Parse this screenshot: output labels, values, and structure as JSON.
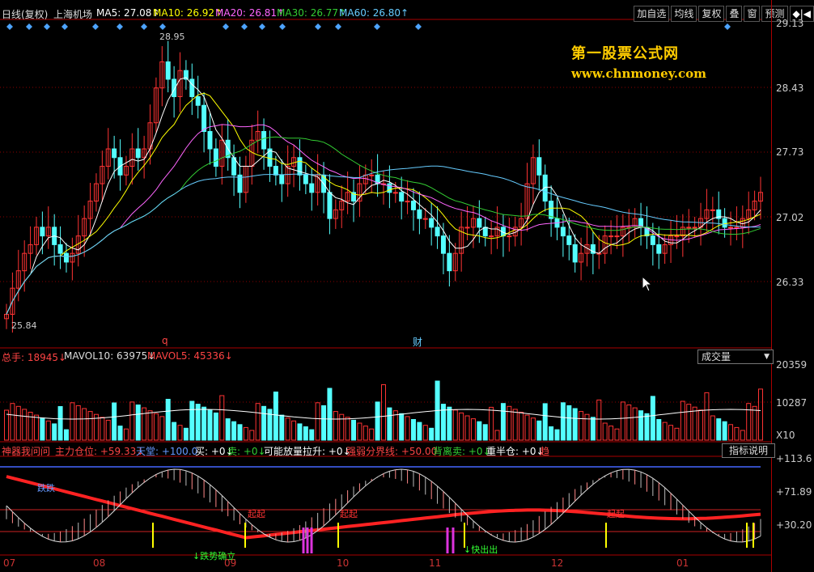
{
  "colors": {
    "up": "#ff3333",
    "down": "#54ffff",
    "ma5": "#ffffff",
    "ma10": "#ffff00",
    "ma20": "#ff66ff",
    "ma30": "#33cc33",
    "ma60": "#66ccff",
    "grid": "#8b0000",
    "thick_line": "#ff2222"
  },
  "header": {
    "period": "日线(复权)",
    "stock_name": "上海机场",
    "ma5": "MA5: 27.08↑",
    "ma10": "MA10: 26.92↑",
    "ma20": "MA20: 26.81↑",
    "ma30": "MA30: 26.77↑",
    "ma60": "MA60: 26.80↑"
  },
  "toolbar": {
    "add_watch": "加自选",
    "ma": "均线",
    "restore": "复权",
    "overlay": "叠",
    "window": "窗",
    "forecast": "预测",
    "toggle": "◆|◀"
  },
  "watermark": {
    "line1": "第一股票公式网",
    "line2": "www.chnmoney.com"
  },
  "price_axis": {
    "ticks": [
      "29.13",
      "28.43",
      "27.73",
      "27.02",
      "26.33"
    ],
    "high_label": "28.95",
    "low_label": "25.84"
  },
  "markers": {
    "q": "q",
    "cai": "财"
  },
  "volume": {
    "total_label": "总手: 18945↓",
    "mavol10": "MAVOL10: 63975↓",
    "mavol5": "MAVOL5: 45336↓",
    "selector": "成交量",
    "ticks": [
      "20359",
      "10287",
      "X10"
    ]
  },
  "indicator": {
    "name": "神器我问问",
    "main_pos": "主力仓位: +59.33↓",
    "top": "天堂: +100.0",
    "buy": "买: +0↓",
    "sell": "卖: +0↓",
    "vol_pull": "可能放量拉升: +0↓",
    "strong_weak": "强弱分界线: +50.00",
    "leave_sell": "背离卖: +0↓",
    "half_pos": "重半仓: +0↓",
    "trend": "趋",
    "help": "指标说明",
    "ticks": [
      "+113.6",
      "+71.89",
      "+30.20"
    ],
    "labels": {
      "rise1": "起起",
      "rise2": "起起",
      "rise3": "起起",
      "fall": "↓跌势确立",
      "drop": "跌跌",
      "escape": "↓快出出"
    }
  },
  "x_axis": {
    "months": [
      "07",
      "08",
      "09",
      "10",
      "11",
      "12",
      "01"
    ]
  },
  "chart_data": {
    "type": "candlestick",
    "series_name": "上海机场 日线(复权)",
    "ylim": [
      25.7,
      29.25
    ],
    "price_ticks": [
      29.13,
      28.43,
      27.73,
      27.02,
      26.33
    ],
    "high": 28.95,
    "low": 25.84,
    "ma_values": {
      "MA5": 27.08,
      "MA10": 26.92,
      "MA20": 26.81,
      "MA30": 26.77,
      "MA60": 26.8
    },
    "volume_axis": [
      20359,
      10287
    ],
    "indicator_axis": [
      113.6,
      71.89,
      30.2
    ],
    "months": [
      "07",
      "08",
      "09",
      "10",
      "11",
      "12",
      "01"
    ],
    "close": [
      25.9,
      26.2,
      26.4,
      26.6,
      26.7,
      26.9,
      26.8,
      26.9,
      26.7,
      26.6,
      26.5,
      26.6,
      26.8,
      27.0,
      27.2,
      27.4,
      27.6,
      27.8,
      27.7,
      27.5,
      27.6,
      27.8,
      27.7,
      27.8,
      28.1,
      28.5,
      28.8,
      28.6,
      28.4,
      28.7,
      28.6,
      28.4,
      28.3,
      28.0,
      27.8,
      27.6,
      27.9,
      27.7,
      27.5,
      27.3,
      27.6,
      27.9,
      28.0,
      27.8,
      27.6,
      27.5,
      27.4,
      27.6,
      27.7,
      27.5,
      27.4,
      27.3,
      27.5,
      27.3,
      27.0,
      27.1,
      27.2,
      27.3,
      27.2,
      27.4,
      27.5,
      27.5,
      27.4,
      27.4,
      27.3,
      27.3,
      27.2,
      27.2,
      27.1,
      27.0,
      27.0,
      26.9,
      26.8,
      26.6,
      26.4,
      26.6,
      26.9,
      26.9,
      27.0,
      26.9,
      26.8,
      26.8,
      26.9,
      26.8,
      26.8,
      26.9,
      27.0,
      27.4,
      27.7,
      27.5,
      27.2,
      27.0,
      26.9,
      26.8,
      26.7,
      26.5,
      26.6,
      26.7,
      26.6,
      26.6,
      26.8,
      26.8,
      26.8,
      26.9,
      26.9,
      27.0,
      26.9,
      26.8,
      26.7,
      26.6,
      26.7,
      26.8,
      26.8,
      26.9,
      26.9,
      26.9,
      27.0,
      27.1,
      27.1,
      27.0,
      26.9,
      26.9,
      26.9,
      27.0,
      27.1,
      27.2,
      27.3
    ]
  }
}
